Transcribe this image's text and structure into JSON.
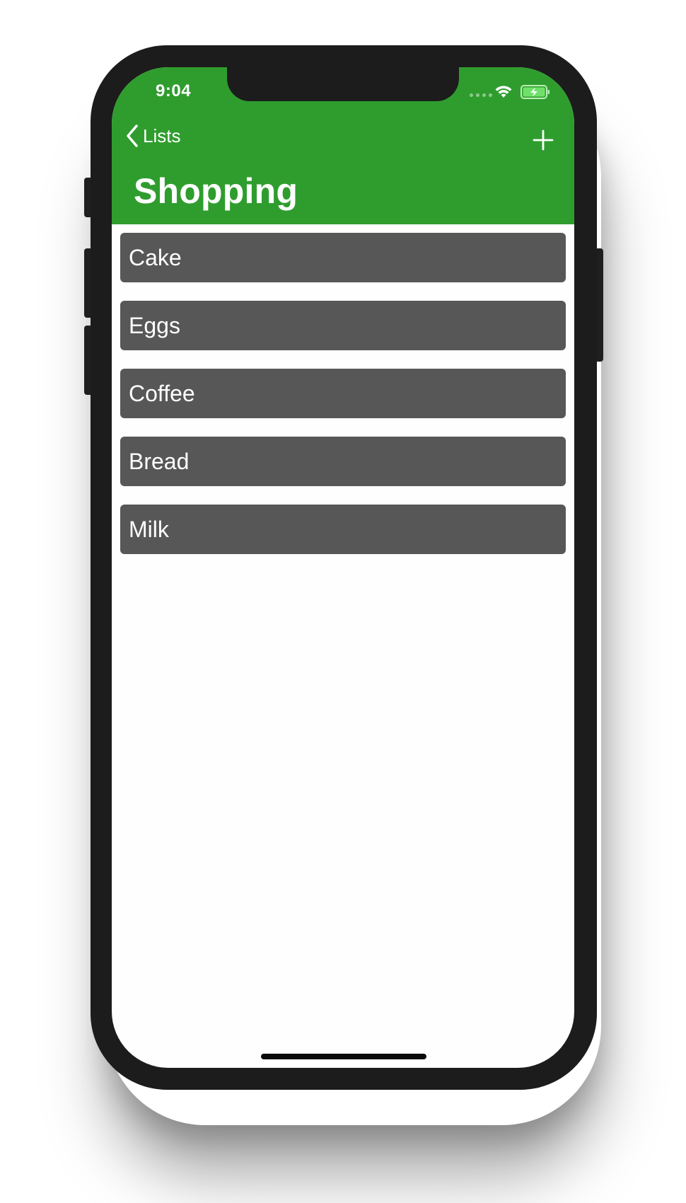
{
  "status_bar": {
    "time": "9:04"
  },
  "nav": {
    "back_label": "Lists",
    "title": "Shopping"
  },
  "items": [
    {
      "label": "Cake"
    },
    {
      "label": "Eggs"
    },
    {
      "label": "Coffee"
    },
    {
      "label": "Bread"
    },
    {
      "label": "Milk"
    }
  ],
  "colors": {
    "header": "#2f9d2e",
    "item_background": "#575757",
    "item_text": "#ffffff",
    "device_frame": "#1c1c1c"
  },
  "icons": {
    "back": "chevron-left-icon",
    "add": "plus-icon",
    "wifi": "wifi-icon",
    "battery": "battery-charging-icon",
    "signal": "cellular-signal-icon"
  }
}
